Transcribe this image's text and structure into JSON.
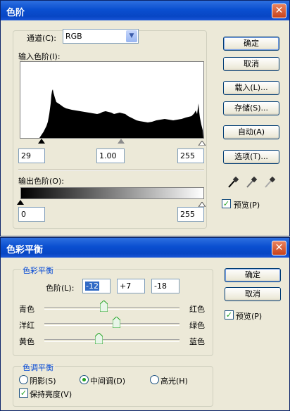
{
  "levels": {
    "title": "色阶",
    "close": "✕",
    "channel_label": "通道(C):",
    "channel_value": "RGB",
    "input_label": "输入色阶(I):",
    "input_black": "29",
    "input_gamma": "1.00",
    "input_white": "255",
    "output_label": "输出色阶(O):",
    "output_black": "0",
    "output_white": "255",
    "buttons": {
      "ok": "确定",
      "cancel": "取消",
      "load": "载入(L)...",
      "save": "存储(S)...",
      "auto": "自动(A)",
      "options": "选项(T)..."
    },
    "preview_label": "预览(P)",
    "preview_checked": true
  },
  "color_balance": {
    "title": "色彩平衡",
    "close": "✕",
    "group_balance": "色彩平衡",
    "levels_label": "色阶(L):",
    "level_values": [
      "-12",
      "+7",
      "-18"
    ],
    "sliders": [
      {
        "left": "青色",
        "right": "红色",
        "value": -12
      },
      {
        "left": "洋红",
        "right": "绿色",
        "value": 7
      },
      {
        "left": "黄色",
        "right": "蓝色",
        "value": -18
      }
    ],
    "group_tone": "色调平衡",
    "tones": [
      {
        "label": "阴影(S)",
        "selected": false
      },
      {
        "label": "中间调(D)",
        "selected": true
      },
      {
        "label": "高光(H)",
        "selected": false
      }
    ],
    "preserve_label": "保持亮度(V)",
    "preserve_checked": true,
    "buttons": {
      "ok": "确定",
      "cancel": "取消"
    },
    "preview_label": "预览(P)",
    "preview_checked": true
  },
  "colors": {
    "titlebar": "#0a4fd0",
    "dialog_bg": "#ece9d8",
    "group_label": "#0046d5"
  }
}
